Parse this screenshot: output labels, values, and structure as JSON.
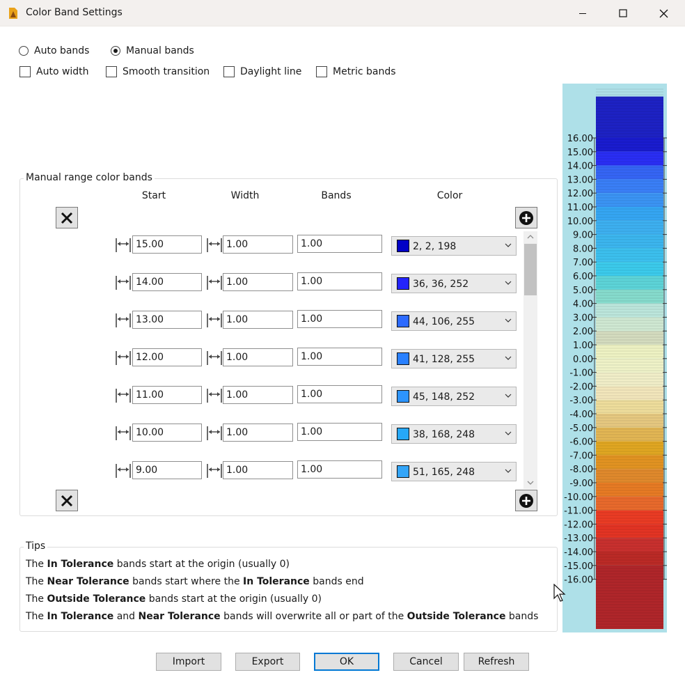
{
  "window": {
    "title": "Color Band Settings"
  },
  "modes": {
    "auto_bands": {
      "label": "Auto bands",
      "checked": false
    },
    "manual_bands": {
      "label": "Manual bands",
      "checked": true
    }
  },
  "options": {
    "auto_width": {
      "label": "Auto width",
      "checked": false
    },
    "smooth_transition": {
      "label": "Smooth transition",
      "checked": false
    },
    "daylight_line": {
      "label": "Daylight line",
      "checked": false
    },
    "metric_bands": {
      "label": "Metric bands",
      "checked": false
    }
  },
  "manual": {
    "title": "Manual range color bands",
    "columns": {
      "start": "Start",
      "width": "Width",
      "bands": "Bands",
      "color": "Color"
    },
    "rows": [
      {
        "start": "15.00",
        "width": "1.00",
        "bands": "1.00",
        "color_label": "2, 2, 198",
        "color": "#0202c6"
      },
      {
        "start": "14.00",
        "width": "1.00",
        "bands": "1.00",
        "color_label": "36, 36, 252",
        "color": "#2424fc"
      },
      {
        "start": "13.00",
        "width": "1.00",
        "bands": "1.00",
        "color_label": "44, 106, 255",
        "color": "#2c6aff"
      },
      {
        "start": "12.00",
        "width": "1.00",
        "bands": "1.00",
        "color_label": "41, 128, 255",
        "color": "#2980ff"
      },
      {
        "start": "11.00",
        "width": "1.00",
        "bands": "1.00",
        "color_label": "45, 148, 252",
        "color": "#2d94fc"
      },
      {
        "start": "10.00",
        "width": "1.00",
        "bands": "1.00",
        "color_label": "38, 168, 248",
        "color": "#26a8f8"
      },
      {
        "start": "9.00",
        "width": "1.00",
        "bands": "1.00",
        "color_label": "51, 165, 248",
        "color": "#33a5f8"
      }
    ]
  },
  "tips": {
    "title": "Tips",
    "line1": {
      "a": "The ",
      "b": "In Tolerance",
      "c": " bands start at the origin (usually 0)"
    },
    "line2": {
      "a": "The ",
      "b": "Near Tolerance",
      "c": " bands start where the ",
      "d": "In Tolerance",
      "e": " bands end"
    },
    "line3": {
      "a": "The ",
      "b": "Outside Tolerance",
      "c": " bands start at the origin (usually 0)"
    },
    "line4": {
      "a": "The ",
      "b": "In Tolerance",
      "c": " and ",
      "d": "Near Tolerance",
      "e": " bands will overwrite all or part of the ",
      "f": "Outside Tolerance",
      "g": " bands"
    }
  },
  "buttons": {
    "import": "Import",
    "export": "Export",
    "ok": "OK",
    "cancel": "Cancel",
    "refresh": "Refresh"
  },
  "colors": {
    "legend_background": "#aee0e8",
    "accent": "#0078d4"
  },
  "legend": {
    "ticks": [
      16,
      15,
      14,
      13,
      12,
      11,
      10,
      9,
      8,
      7,
      6,
      5,
      4,
      3,
      2,
      1,
      0,
      -1,
      -2,
      -3,
      -4,
      -5,
      -6,
      -7,
      -8,
      -9,
      -10,
      -11,
      -12,
      -13,
      -14,
      -15,
      -16
    ],
    "tick_labels": [
      "16.00",
      "15.00",
      "14.00",
      "13.00",
      "12.00",
      "11.00",
      "10.00",
      "9.00",
      "8.00",
      "7.00",
      "6.00",
      "5.00",
      "4.00",
      "3.00",
      "2.00",
      "1.00",
      "0.00",
      "-1.00",
      "-2.00",
      "-3.00",
      "-4.00",
      "-5.00",
      "-6.00",
      "-7.00",
      "-8.00",
      "-9.00",
      "-10.00",
      "-11.00",
      "-12.00",
      "-13.00",
      "-14.00",
      "-15.00",
      "-16.00"
    ],
    "bands": [
      {
        "from": 19,
        "to": 16,
        "color": "#1d22c4"
      },
      {
        "from": 16,
        "to": 15,
        "color": "#1a1ccf"
      },
      {
        "from": 15,
        "to": 14,
        "color": "#2a2ef4"
      },
      {
        "from": 14,
        "to": 13,
        "color": "#3565f5"
      },
      {
        "from": 13,
        "to": 12,
        "color": "#3a7ff7"
      },
      {
        "from": 12,
        "to": 11,
        "color": "#3b94f4"
      },
      {
        "from": 11,
        "to": 10,
        "color": "#35a6f3"
      },
      {
        "from": 10,
        "to": 9,
        "color": "#3db0f0"
      },
      {
        "from": 9,
        "to": 8,
        "color": "#3cb6ef"
      },
      {
        "from": 8,
        "to": 7,
        "color": "#3cc0ee"
      },
      {
        "from": 7,
        "to": 6,
        "color": "#3ccbec"
      },
      {
        "from": 6,
        "to": 5,
        "color": "#5dd4d8"
      },
      {
        "from": 5,
        "to": 4,
        "color": "#86dccd"
      },
      {
        "from": 4,
        "to": 3,
        "color": "#bce6dc"
      },
      {
        "from": 3,
        "to": 2,
        "color": "#cfe8d2"
      },
      {
        "from": 2,
        "to": 1,
        "color": "#d4dcbf"
      },
      {
        "from": 1,
        "to": 0,
        "color": "#eef2c3"
      },
      {
        "from": 0,
        "to": -1,
        "color": "#eff2c8"
      },
      {
        "from": -1,
        "to": -2,
        "color": "#f1eec8"
      },
      {
        "from": -2,
        "to": -3,
        "color": "#f2e6bb"
      },
      {
        "from": -3,
        "to": -4,
        "color": "#eedd9c"
      },
      {
        "from": -4,
        "to": -5,
        "color": "#e6c880"
      },
      {
        "from": -5,
        "to": -6,
        "color": "#e2b654"
      },
      {
        "from": -6,
        "to": -7,
        "color": "#e0a622"
      },
      {
        "from": -7,
        "to": -8,
        "color": "#e29322"
      },
      {
        "from": -8,
        "to": -9,
        "color": "#e0892c"
      },
      {
        "from": -9,
        "to": -10,
        "color": "#e77b24"
      },
      {
        "from": -10,
        "to": -11,
        "color": "#e86a2c"
      },
      {
        "from": -11,
        "to": -12,
        "color": "#ea3c24"
      },
      {
        "from": -12,
        "to": -13,
        "color": "#e33424"
      },
      {
        "from": -13,
        "to": -14,
        "color": "#c8302e"
      },
      {
        "from": -14,
        "to": -15,
        "color": "#bb2a26"
      },
      {
        "from": -15,
        "to": -23,
        "color": "#b0262a"
      }
    ]
  }
}
